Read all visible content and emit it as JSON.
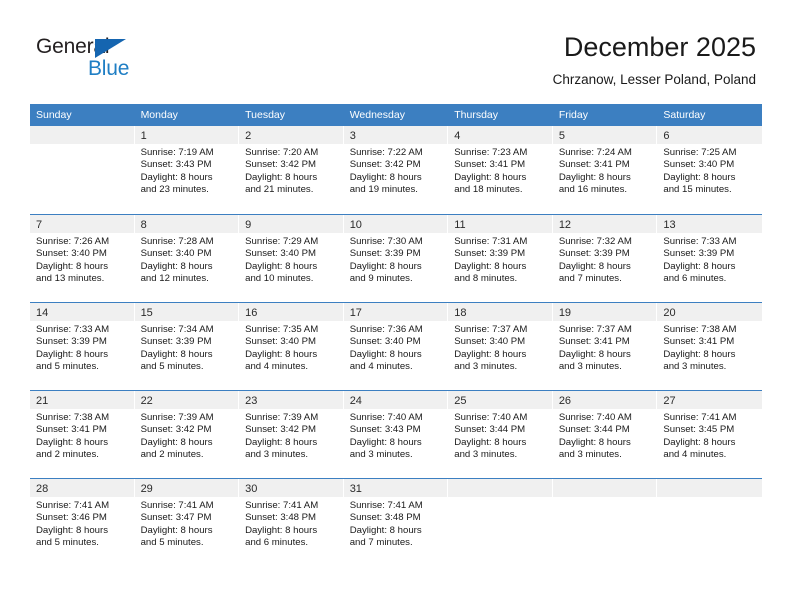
{
  "brand": {
    "name_top": "General",
    "name_bottom": "Blue",
    "accent_color": "#1f7ec4",
    "triangle_color": "#1565b0"
  },
  "header": {
    "title": "December 2025",
    "location": "Chrzanow, Lesser Poland, Poland"
  },
  "theme": {
    "header_row_bg": "#3c7fc1",
    "header_row_text": "#ffffff",
    "day_band_bg": "#f0f0f0",
    "row_divider": "#3c7fc1"
  },
  "weekdays": [
    "Sunday",
    "Monday",
    "Tuesday",
    "Wednesday",
    "Thursday",
    "Friday",
    "Saturday"
  ],
  "weeks": [
    [
      {
        "day": "",
        "lines": []
      },
      {
        "day": "1",
        "lines": [
          "Sunrise: 7:19 AM",
          "Sunset: 3:43 PM",
          "Daylight: 8 hours",
          "and 23 minutes."
        ]
      },
      {
        "day": "2",
        "lines": [
          "Sunrise: 7:20 AM",
          "Sunset: 3:42 PM",
          "Daylight: 8 hours",
          "and 21 minutes."
        ]
      },
      {
        "day": "3",
        "lines": [
          "Sunrise: 7:22 AM",
          "Sunset: 3:42 PM",
          "Daylight: 8 hours",
          "and 19 minutes."
        ]
      },
      {
        "day": "4",
        "lines": [
          "Sunrise: 7:23 AM",
          "Sunset: 3:41 PM",
          "Daylight: 8 hours",
          "and 18 minutes."
        ]
      },
      {
        "day": "5",
        "lines": [
          "Sunrise: 7:24 AM",
          "Sunset: 3:41 PM",
          "Daylight: 8 hours",
          "and 16 minutes."
        ]
      },
      {
        "day": "6",
        "lines": [
          "Sunrise: 7:25 AM",
          "Sunset: 3:40 PM",
          "Daylight: 8 hours",
          "and 15 minutes."
        ]
      }
    ],
    [
      {
        "day": "7",
        "lines": [
          "Sunrise: 7:26 AM",
          "Sunset: 3:40 PM",
          "Daylight: 8 hours",
          "and 13 minutes."
        ]
      },
      {
        "day": "8",
        "lines": [
          "Sunrise: 7:28 AM",
          "Sunset: 3:40 PM",
          "Daylight: 8 hours",
          "and 12 minutes."
        ]
      },
      {
        "day": "9",
        "lines": [
          "Sunrise: 7:29 AM",
          "Sunset: 3:40 PM",
          "Daylight: 8 hours",
          "and 10 minutes."
        ]
      },
      {
        "day": "10",
        "lines": [
          "Sunrise: 7:30 AM",
          "Sunset: 3:39 PM",
          "Daylight: 8 hours",
          "and 9 minutes."
        ]
      },
      {
        "day": "11",
        "lines": [
          "Sunrise: 7:31 AM",
          "Sunset: 3:39 PM",
          "Daylight: 8 hours",
          "and 8 minutes."
        ]
      },
      {
        "day": "12",
        "lines": [
          "Sunrise: 7:32 AM",
          "Sunset: 3:39 PM",
          "Daylight: 8 hours",
          "and 7 minutes."
        ]
      },
      {
        "day": "13",
        "lines": [
          "Sunrise: 7:33 AM",
          "Sunset: 3:39 PM",
          "Daylight: 8 hours",
          "and 6 minutes."
        ]
      }
    ],
    [
      {
        "day": "14",
        "lines": [
          "Sunrise: 7:33 AM",
          "Sunset: 3:39 PM",
          "Daylight: 8 hours",
          "and 5 minutes."
        ]
      },
      {
        "day": "15",
        "lines": [
          "Sunrise: 7:34 AM",
          "Sunset: 3:39 PM",
          "Daylight: 8 hours",
          "and 5 minutes."
        ]
      },
      {
        "day": "16",
        "lines": [
          "Sunrise: 7:35 AM",
          "Sunset: 3:40 PM",
          "Daylight: 8 hours",
          "and 4 minutes."
        ]
      },
      {
        "day": "17",
        "lines": [
          "Sunrise: 7:36 AM",
          "Sunset: 3:40 PM",
          "Daylight: 8 hours",
          "and 4 minutes."
        ]
      },
      {
        "day": "18",
        "lines": [
          "Sunrise: 7:37 AM",
          "Sunset: 3:40 PM",
          "Daylight: 8 hours",
          "and 3 minutes."
        ]
      },
      {
        "day": "19",
        "lines": [
          "Sunrise: 7:37 AM",
          "Sunset: 3:41 PM",
          "Daylight: 8 hours",
          "and 3 minutes."
        ]
      },
      {
        "day": "20",
        "lines": [
          "Sunrise: 7:38 AM",
          "Sunset: 3:41 PM",
          "Daylight: 8 hours",
          "and 3 minutes."
        ]
      }
    ],
    [
      {
        "day": "21",
        "lines": [
          "Sunrise: 7:38 AM",
          "Sunset: 3:41 PM",
          "Daylight: 8 hours",
          "and 2 minutes."
        ]
      },
      {
        "day": "22",
        "lines": [
          "Sunrise: 7:39 AM",
          "Sunset: 3:42 PM",
          "Daylight: 8 hours",
          "and 2 minutes."
        ]
      },
      {
        "day": "23",
        "lines": [
          "Sunrise: 7:39 AM",
          "Sunset: 3:42 PM",
          "Daylight: 8 hours",
          "and 3 minutes."
        ]
      },
      {
        "day": "24",
        "lines": [
          "Sunrise: 7:40 AM",
          "Sunset: 3:43 PM",
          "Daylight: 8 hours",
          "and 3 minutes."
        ]
      },
      {
        "day": "25",
        "lines": [
          "Sunrise: 7:40 AM",
          "Sunset: 3:44 PM",
          "Daylight: 8 hours",
          "and 3 minutes."
        ]
      },
      {
        "day": "26",
        "lines": [
          "Sunrise: 7:40 AM",
          "Sunset: 3:44 PM",
          "Daylight: 8 hours",
          "and 3 minutes."
        ]
      },
      {
        "day": "27",
        "lines": [
          "Sunrise: 7:41 AM",
          "Sunset: 3:45 PM",
          "Daylight: 8 hours",
          "and 4 minutes."
        ]
      }
    ],
    [
      {
        "day": "28",
        "lines": [
          "Sunrise: 7:41 AM",
          "Sunset: 3:46 PM",
          "Daylight: 8 hours",
          "and 5 minutes."
        ]
      },
      {
        "day": "29",
        "lines": [
          "Sunrise: 7:41 AM",
          "Sunset: 3:47 PM",
          "Daylight: 8 hours",
          "and 5 minutes."
        ]
      },
      {
        "day": "30",
        "lines": [
          "Sunrise: 7:41 AM",
          "Sunset: 3:48 PM",
          "Daylight: 8 hours",
          "and 6 minutes."
        ]
      },
      {
        "day": "31",
        "lines": [
          "Sunrise: 7:41 AM",
          "Sunset: 3:48 PM",
          "Daylight: 8 hours",
          "and 7 minutes."
        ]
      },
      {
        "day": "",
        "lines": []
      },
      {
        "day": "",
        "lines": []
      },
      {
        "day": "",
        "lines": []
      }
    ]
  ]
}
